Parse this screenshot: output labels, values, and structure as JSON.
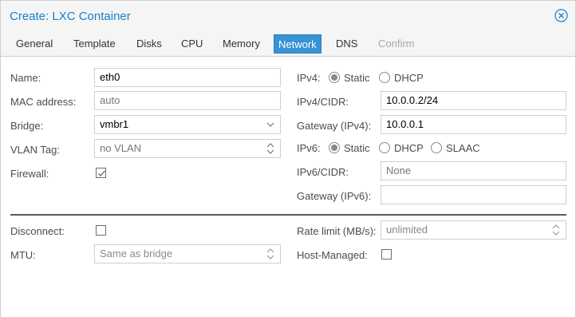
{
  "window": {
    "title": "Create: LXC Container"
  },
  "tabs": [
    {
      "label": "General",
      "state": "normal"
    },
    {
      "label": "Template",
      "state": "normal"
    },
    {
      "label": "Disks",
      "state": "normal"
    },
    {
      "label": "CPU",
      "state": "normal"
    },
    {
      "label": "Memory",
      "state": "normal"
    },
    {
      "label": "Network",
      "state": "active"
    },
    {
      "label": "DNS",
      "state": "normal"
    },
    {
      "label": "Confirm",
      "state": "disabled"
    }
  ],
  "left": {
    "name": {
      "label": "Name:",
      "value": "eth0"
    },
    "mac": {
      "label": "MAC address:",
      "placeholder": "auto"
    },
    "bridge": {
      "label": "Bridge:",
      "value": "vmbr1"
    },
    "vlan": {
      "label": "VLAN Tag:",
      "placeholder": "no VLAN"
    },
    "firewall": {
      "label": "Firewall:",
      "checked": true
    }
  },
  "right": {
    "ipv4": {
      "label": "IPv4:",
      "options": [
        "Static",
        "DHCP"
      ],
      "selected": "Static"
    },
    "ipv4_cidr": {
      "label": "IPv4/CIDR:",
      "value": "10.0.0.2/24"
    },
    "gateway4": {
      "label": "Gateway (IPv4):",
      "value": "10.0.0.1"
    },
    "ipv6": {
      "label": "IPv6:",
      "options": [
        "Static",
        "DHCP",
        "SLAAC"
      ],
      "selected": "Static"
    },
    "ipv6_cidr": {
      "label": "IPv6/CIDR:",
      "placeholder": "None"
    },
    "gateway6": {
      "label": "Gateway (IPv6):",
      "value": ""
    }
  },
  "advanced": {
    "disconnect": {
      "label": "Disconnect:",
      "checked": false
    },
    "mtu": {
      "label": "MTU:",
      "placeholder": "Same as bridge"
    },
    "rate": {
      "label": "Rate limit (MB/s):",
      "placeholder": "unlimited"
    },
    "host_managed": {
      "label": "Host-Managed:",
      "checked": false
    }
  },
  "colors": {
    "accent": "#157fcc",
    "active_tab": "#3892d4"
  },
  "icons": {
    "close": "close-circle-icon",
    "dropdown": "chevron-down-icon",
    "spinner": "spinner-arrows-icon",
    "check": "check-icon"
  }
}
